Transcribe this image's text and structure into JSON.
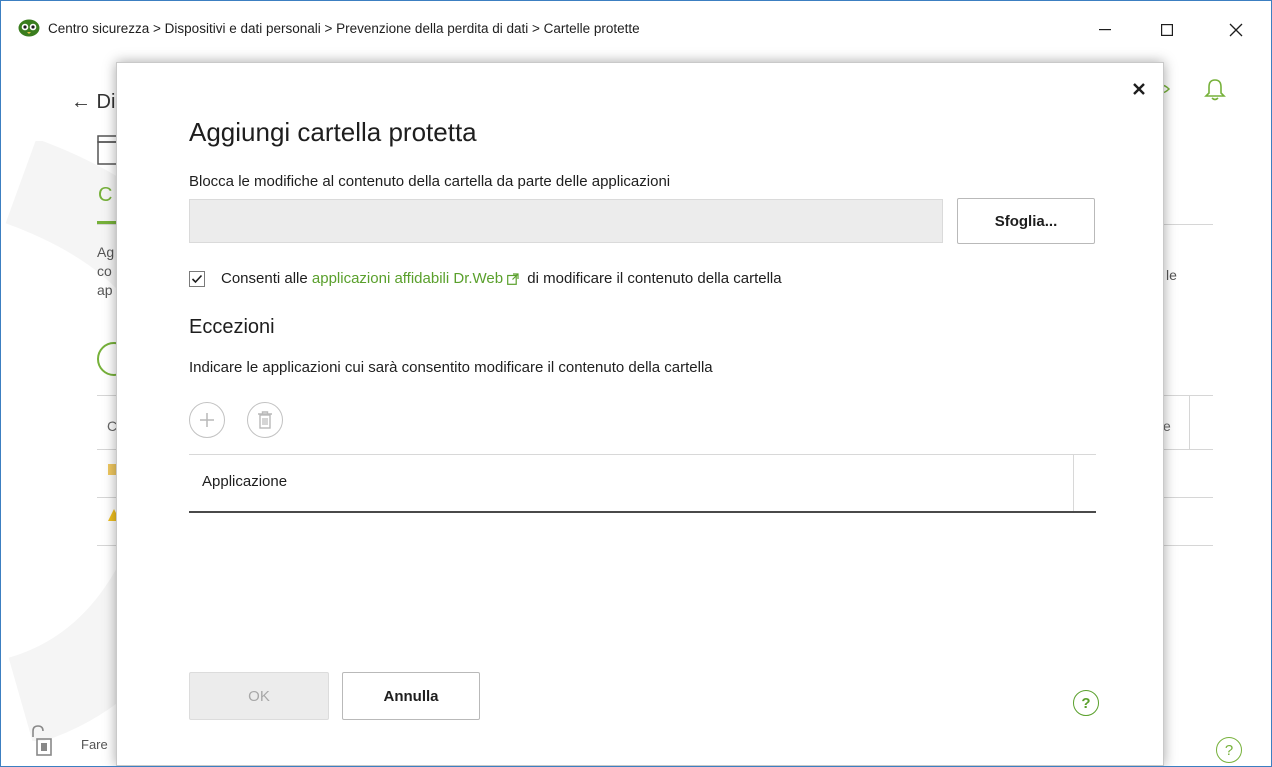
{
  "window": {
    "breadcrumb": "Centro sicurezza > Dispositivi e dati personali > Prevenzione della perdita di dati > Cartelle protette",
    "minimize_icon": "minimize-icon",
    "maximize_icon": "maximize-icon",
    "close_icon": "close-icon"
  },
  "background": {
    "back_text": "← Di",
    "tab_initial": "C",
    "desc_lines": [
      "Ag",
      "co",
      "ap"
    ],
    "right_text": "le",
    "column_c": "C",
    "column_e": "e",
    "footer_text": "Fare"
  },
  "dialog": {
    "title": "Aggiungi cartella protetta",
    "subtitle": "Blocca le modifiche al contenuto della cartella da parte delle applicazioni",
    "path_value": "",
    "browse_label": "Sfoglia...",
    "checkbox_checked": true,
    "checkbox_prefix": "Consenti alle ",
    "checkbox_link": "applicazioni affidabili Dr.Web",
    "checkbox_suffix": " di modificare il contenuto della cartella",
    "exceptions_title": "Eccezioni",
    "exceptions_desc": "Indicare le applicazioni cui sarà consentito modificare il contenuto della cartella",
    "table_header": "Applicazione",
    "ok_label": "OK",
    "cancel_label": "Annulla",
    "help_label": "?"
  },
  "colors": {
    "accent_green": "#5aa02c",
    "window_border": "#3c7fc1"
  }
}
